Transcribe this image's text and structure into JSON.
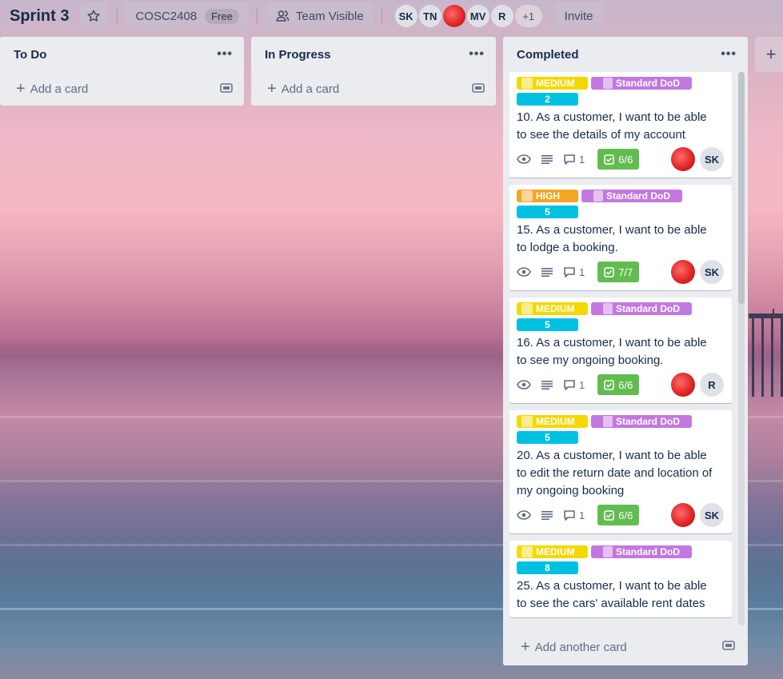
{
  "header": {
    "board_title": "Sprint 3",
    "workspace": "COSC2408",
    "workspace_badge": "Free",
    "visibility": "Team Visible",
    "members": [
      "SK",
      "TN",
      "MV",
      "R"
    ],
    "more_members": "+1",
    "invite": "Invite"
  },
  "lists": [
    {
      "title": "To Do",
      "add_card": "Add a card"
    },
    {
      "title": "In Progress",
      "add_card": "Add a card"
    },
    {
      "title": "Completed",
      "add_another": "Add another card",
      "cards": [
        {
          "priority": "MEDIUM",
          "dod": "Standard DoD",
          "points": "2",
          "title": "10. As a customer, I want to be able to see the details of my account",
          "comments": "1",
          "checklist": "6/6",
          "member": "SK"
        },
        {
          "priority": "HIGH",
          "dod": "Standard DoD",
          "points": "5",
          "title": "15. As a customer, I want to be able to lodge a booking.",
          "comments": "1",
          "checklist": "7/7",
          "member": "SK"
        },
        {
          "priority": "MEDIUM",
          "dod": "Standard DoD",
          "points": "5",
          "title": "16. As a customer, I want to be able to see my ongoing booking.",
          "comments": "1",
          "checklist": "6/6",
          "member": "R"
        },
        {
          "priority": "MEDIUM",
          "dod": "Standard DoD",
          "points": "5",
          "title": "20. As a customer, I want to be able to edit the return date and location of my ongoing booking",
          "comments": "1",
          "checklist": "6/6",
          "member": "SK"
        },
        {
          "priority": "MEDIUM",
          "dod": "Standard DoD",
          "points": "8",
          "title": "25. As a customer, I want to be able to see the cars' available rent dates",
          "comments": "",
          "checklist": "",
          "member": ""
        }
      ]
    }
  ],
  "colors": {
    "medium": "#f5d800",
    "high": "#f5a623",
    "dod": "#c377e0",
    "points": "#00c2e0",
    "checklist_done": "#61bd4f"
  },
  "icons": [
    "star-icon",
    "team-icon",
    "plus-icon",
    "template-icon",
    "ellipsis-icon",
    "eye-icon",
    "description-icon",
    "comment-icon",
    "checklist-icon"
  ]
}
